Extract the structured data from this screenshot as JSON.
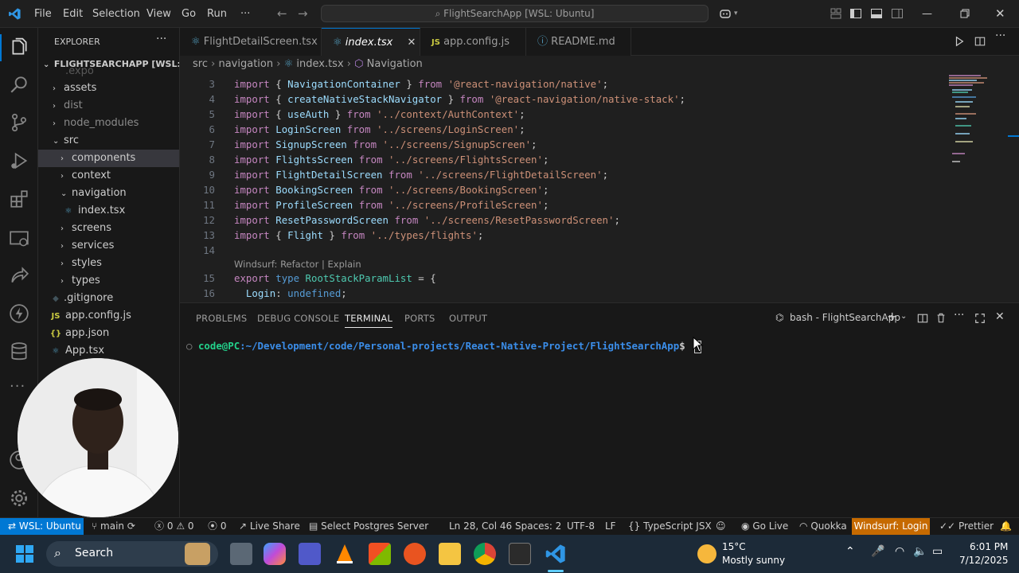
{
  "titlebar": {
    "menus": [
      "File",
      "Edit",
      "Selection",
      "View",
      "Go",
      "Run",
      "···"
    ],
    "search_text": "FlightSearchApp [WSL: Ubuntu]"
  },
  "explorer": {
    "title": "EXPLORER",
    "root": "FLIGHTSEARCHAPP [WSL: U...",
    "items": [
      {
        "label": ".expo",
        "type": "folder"
      },
      {
        "label": "assets",
        "type": "folder"
      },
      {
        "label": "dist",
        "type": "folder"
      },
      {
        "label": "node_modules",
        "type": "folder"
      },
      {
        "label": "src",
        "type": "folder-open"
      },
      {
        "label": "components",
        "type": "folder"
      },
      {
        "label": "context",
        "type": "folder"
      },
      {
        "label": "navigation",
        "type": "folder-open"
      },
      {
        "label": "index.tsx",
        "type": "file"
      },
      {
        "label": "screens",
        "type": "folder"
      },
      {
        "label": "services",
        "type": "folder"
      },
      {
        "label": "styles",
        "type": "folder"
      },
      {
        "label": "types",
        "type": "folder"
      },
      {
        "label": ".gitignore",
        "type": "file"
      },
      {
        "label": "app.config.js",
        "type": "file"
      },
      {
        "label": "app.json",
        "type": "file"
      },
      {
        "label": "App.tsx",
        "type": "file"
      }
    ]
  },
  "tabs": [
    {
      "label": "FlightDetailScreen.tsx"
    },
    {
      "label": "index.tsx",
      "close": "✕"
    },
    {
      "label": "app.config.js"
    },
    {
      "label": "README.md"
    }
  ],
  "breadcrumb": [
    "src",
    "navigation",
    "index.tsx",
    "Navigation"
  ],
  "editor": {
    "lines": [
      {
        "n": "3",
        "t": "import { NavigationContainer } from '@react-navigation/native';"
      },
      {
        "n": "4",
        "t": "import { createNativeStackNavigator } from '@react-navigation/native-stack';"
      },
      {
        "n": "5",
        "t": "import { useAuth } from '../context/AuthContext';"
      },
      {
        "n": "6",
        "t": "import LoginScreen from '../screens/LoginScreen';"
      },
      {
        "n": "7",
        "t": "import SignupScreen from '../screens/SignupScreen';"
      },
      {
        "n": "8",
        "t": "import FlightsScreen from '../screens/FlightsScreen';"
      },
      {
        "n": "9",
        "t": "import FlightDetailScreen from '../screens/FlightDetailScreen';"
      },
      {
        "n": "10",
        "t": "import BookingScreen from '../screens/BookingScreen';"
      },
      {
        "n": "11",
        "t": "import ProfileScreen from '../screens/ProfileScreen';"
      },
      {
        "n": "12",
        "t": "import ResetPasswordScreen from '../screens/ResetPasswordScreen';"
      },
      {
        "n": "13",
        "t": "import { Flight } from '../types/flights';"
      },
      {
        "n": "14",
        "t": ""
      },
      {
        "n": "15",
        "t": "export type RootStackParamList = {"
      },
      {
        "n": "16",
        "t": "  Login: undefined;"
      }
    ],
    "codelens": "Windsurf: Refactor | Explain"
  },
  "panel": {
    "tabs": [
      "PROBLEMS",
      "DEBUG CONSOLE",
      "TERMINAL",
      "PORTS",
      "OUTPUT"
    ],
    "terminal_name": "bash - FlightSearchApp",
    "prompt_user": "code@PC",
    "prompt_path": ":~/Development/code/Personal-projects/React-Native-Project/FlightSearchApp",
    "prompt_sign": "$"
  },
  "statusbar": {
    "remote": "WSL: Ubuntu",
    "branch": "main",
    "errors": "0",
    "warnings": "0",
    "ports": "0",
    "live_share": "Live Share",
    "postgres": "Select Postgres Server",
    "position": "Ln 28, Col 46",
    "spaces": "Spaces: 2",
    "encoding": "UTF-8",
    "eol": "LF",
    "language": "TypeScript JSX",
    "go_live": "Go Live",
    "quokka": "Quokka",
    "windsurf": "Windsurf: Login",
    "prettier": "Prettier"
  },
  "taskbar": {
    "search": "Search",
    "temperature": "15°C",
    "weather": "Mostly sunny",
    "time": "6:01 PM",
    "date": "7/12/2025"
  },
  "colors": {
    "accent": "#0078d4",
    "remote_bg": "#0078d4",
    "windsurf_bg": "#c66a00"
  }
}
